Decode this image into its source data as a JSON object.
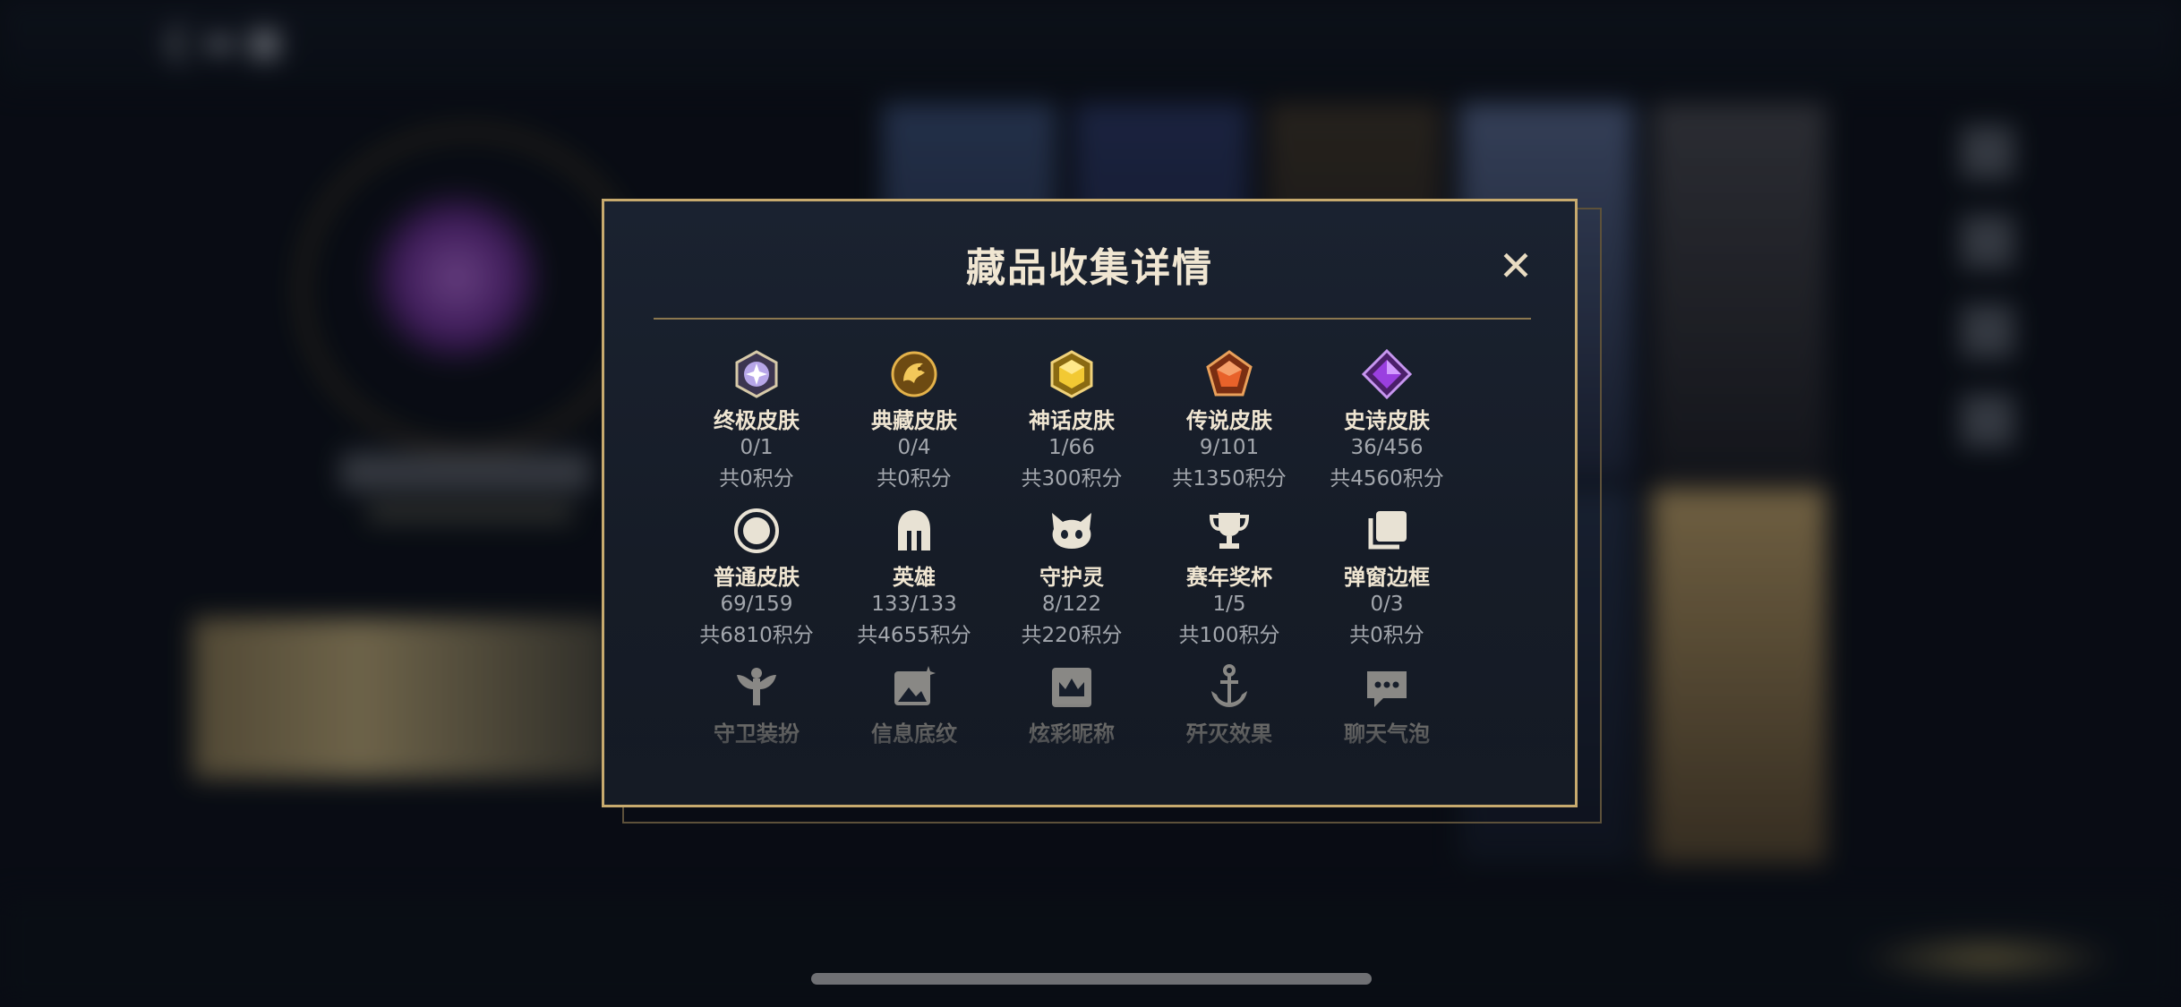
{
  "dialog": {
    "title": "藏品收集详情",
    "close_glyph": "✕",
    "items": [
      {
        "icon": "ultimate-skin-icon",
        "label": "终极皮肤",
        "count": "0/1",
        "points": "共0积分"
      },
      {
        "icon": "prestige-skin-icon",
        "label": "典藏皮肤",
        "count": "0/4",
        "points": "共0积分"
      },
      {
        "icon": "mythic-skin-icon",
        "label": "神话皮肤",
        "count": "1/66",
        "points": "共300积分"
      },
      {
        "icon": "legendary-skin-icon",
        "label": "传说皮肤",
        "count": "9/101",
        "points": "共1350积分"
      },
      {
        "icon": "epic-skin-icon",
        "label": "史诗皮肤",
        "count": "36/456",
        "points": "共4560积分"
      },
      {
        "icon": "regular-skin-icon",
        "label": "普通皮肤",
        "count": "69/159",
        "points": "共6810积分"
      },
      {
        "icon": "champion-helmet-icon",
        "label": "英雄",
        "count": "133/133",
        "points": "共4655积分"
      },
      {
        "icon": "little-legend-icon",
        "label": "守护灵",
        "count": "8/122",
        "points": "共220积分"
      },
      {
        "icon": "trophy-icon",
        "label": "赛年奖杯",
        "count": "1/5",
        "points": "共100积分"
      },
      {
        "icon": "popup-frame-icon",
        "label": "弹窗边框",
        "count": "0/3",
        "points": "共0积分"
      },
      {
        "icon": "ward-skin-icon",
        "label": "守卫装扮"
      },
      {
        "icon": "profile-banner-icon",
        "label": "信息底纹"
      },
      {
        "icon": "crown-nameplate-icon",
        "label": "炫彩昵称"
      },
      {
        "icon": "anchor-finisher-icon",
        "label": "歼灭效果"
      },
      {
        "icon": "chat-bubble-icon",
        "label": "聊天气泡"
      }
    ]
  },
  "colors": {
    "frame_gold": "#c7aa6e",
    "title_text": "#f0e6d2",
    "secondary_text": "#a3a7ad",
    "dialog_bg": "#18202c"
  }
}
